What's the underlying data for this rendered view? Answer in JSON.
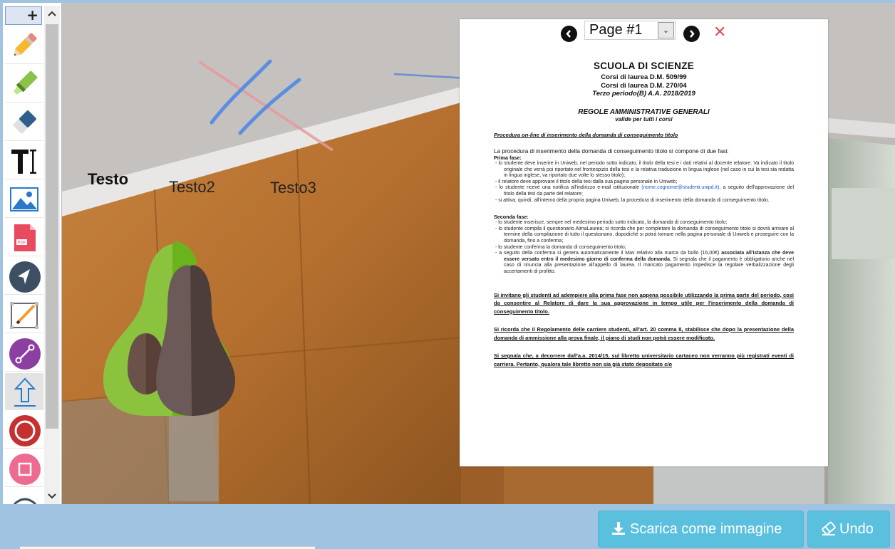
{
  "toolbar": {
    "add_label": "+",
    "tools": [
      {
        "name": "pencil-tool",
        "icon": "pencil-icon"
      },
      {
        "name": "highlighter-tool",
        "icon": "highlighter-icon"
      },
      {
        "name": "eraser-tool",
        "icon": "eraser-icon"
      },
      {
        "name": "text-tool",
        "icon": "text-cursor-icon"
      },
      {
        "name": "image-tool",
        "icon": "image-icon"
      },
      {
        "name": "pdf-tool",
        "icon": "pdf-file-icon"
      },
      {
        "name": "pointer-tool",
        "icon": "pointer-arrow-icon"
      },
      {
        "name": "edit-frame-tool",
        "icon": "pencil-frame-icon"
      },
      {
        "name": "line-tool",
        "icon": "line-segment-icon"
      },
      {
        "name": "arrow-tool",
        "icon": "arrow-up-icon",
        "selected": true
      },
      {
        "name": "circle-tool",
        "icon": "circle-icon"
      },
      {
        "name": "rectangle-tool",
        "icon": "rectangle-icon"
      }
    ]
  },
  "canvas": {
    "texts": [
      "Testo",
      "Testo2",
      "Testo3"
    ]
  },
  "document": {
    "page_label": "Page #1",
    "prev_icon": "chevron-left-icon",
    "next_icon": "chevron-right-icon",
    "close_icon": "close-icon",
    "title": "SCUOLA DI  SCIENZE",
    "subtitle1": "Corsi di laurea D.M. 509/99",
    "subtitle2": "Corsi di laurea D.M. 270/04",
    "subtitle3": "Terzo  periodo(B) A.A. 2018/2019",
    "rules_title": "REGOLE AMMINISTRATIVE GENERALI",
    "rules_sub": "valide per tutti i corsi",
    "procedure": "Procedura on-line di inserimento della domanda di conseguimento titolo",
    "intro": "La procedura di inserimento della domanda di conseguimento titolo si compone di due fasi:",
    "phase1": "Prima fase:",
    "phase1_items": [
      "-  lo studente deve inserire in Uniweb, nel periodo sotto indicato, il titolo della tesi e i dati relativi al docente relatore. Va indicato il titolo originale che verrà poi riportato nel frontespizio della tesi e la relativa traduzione in lingua inglese (nel caso in cui la tesi sia redatta in lingua inglese, va riportato due volte lo stesso titolo);",
      "-  il relatore deve approvare il titolo della tesi dalla sua pagina personale in Uniweb;",
      "-  lo studente riceve una notifica all'indirizzo e-mail istituzionale",
      "(nome.cognome@studenti.unipd.it)",
      ", a seguito dell'approvazione del titolo della tesi da parte del relatore;",
      "-  si attiva, quindi, all'interno della propria pagina Uniweb, la procedura di inserimento della domanda di conseguimento titolo."
    ],
    "phase2": "Seconda fase:",
    "phase2_items": [
      "-  lo studente inserisce, sempre nel medesimo periodo sotto indicato, la domanda di conseguimento titolo;",
      "-  lo studente compila il questionario AlmaLaurea; si ricorda che per completare la domanda di conseguimento titolo si dovrà arrivare al termine della compilazione di tutto il questionario, dopodiché si potrà tornare nella pagina personale di Uniweb e proseguire con la domanda, fino a conferma;",
      "-  lo studente conferma la domanda di conseguimento titolo;",
      "-  a seguito della conferma si genera automaticamente il Mav relativo alla marca da bollo (16,00€)",
      "associata all'istanza che deve essere versato entro il medesimo giorno di conferma della domanda.",
      " Si segnala che il pagamento è obbligatorio anche nel caso di rinuncia alla presentazione all'appello di laurea. Il mancato pagamento impedisce la regolare verbalizzazione degli accertamenti di profitto."
    ],
    "note1": "Si invitano gli studenti ad adempiere alla prima fase non appena possibile utilizzando la prima parte del periodo, così da consentire al Relatore di dare la sua approvazione in tempo utile per l'inserimento della domanda di conseguimento titolo.",
    "note2": "Si ricorda che il Regolamento delle carriere studenti, all'art. 20 comma 8, stabilisce che dopo la presentazione della domanda di ammissione alla prova finale, il piano di studi non potrà essere modificato.",
    "note3": "Si segnala che, a decorrere dall'a.a. 2014/15, sul libretto universitario cartaceo non verranno più registrati eventi di carriera. Pertanto, qualora tale libretto  non sia già stato depositato c/o"
  },
  "actions": {
    "download_label": "Scarica come immagine",
    "download_icon": "download-icon",
    "undo_label": "Undo",
    "undo_icon": "eraser-icon"
  },
  "colors": {
    "button": "#5bc0de",
    "toolbar_border": "#7c98c7",
    "close": "#e24b55",
    "stroke_blue": "#5b8ee0",
    "stroke_red": "#e08a8a"
  }
}
